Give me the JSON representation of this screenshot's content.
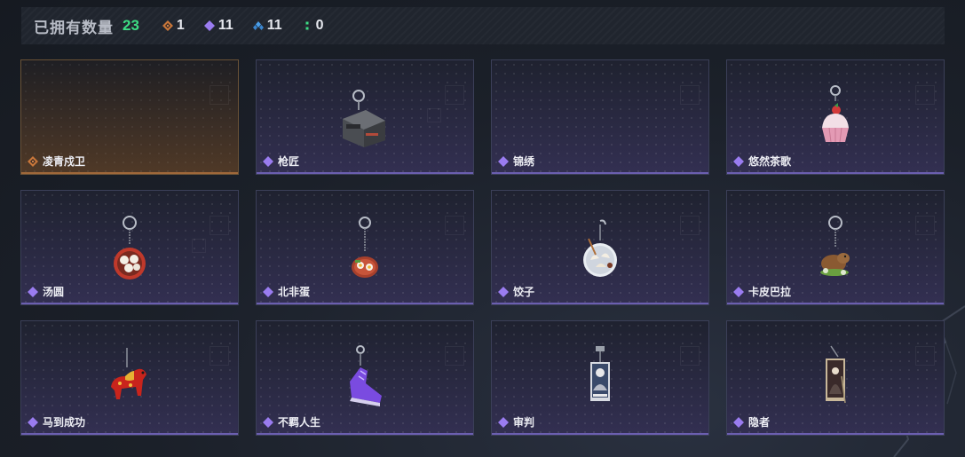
{
  "header": {
    "owned_label": "已拥有数量",
    "owned_count": "23",
    "rarity_counts": [
      {
        "icon": "gold-diamond-icon",
        "color": "#d0803c",
        "count": "1"
      },
      {
        "icon": "purple-diamond-icon",
        "color": "#9a7cf0",
        "count": "11"
      },
      {
        "icon": "blue-diamond-icon",
        "color": "#4a9ee8",
        "count": "11"
      },
      {
        "icon": "green-dots-icon",
        "color": "#3ddc84",
        "count": "0"
      }
    ]
  },
  "colors": {
    "accent_green": "#3ddc84",
    "purple_rarity": "#9a7cf0",
    "gold_rarity": "#d0803c"
  },
  "items": [
    {
      "name": "凌青戍卫",
      "rarity": "gold",
      "icon": "empty"
    },
    {
      "name": "枪匠",
      "rarity": "purple",
      "icon": "gun-case-charm-icon"
    },
    {
      "name": "锦绣",
      "rarity": "purple",
      "icon": "empty"
    },
    {
      "name": "悠然茶歌",
      "rarity": "purple",
      "icon": "cupcake-charm-icon"
    },
    {
      "name": "汤圆",
      "rarity": "purple",
      "icon": "tangyuan-bowl-charm-icon"
    },
    {
      "name": "北非蛋",
      "rarity": "purple",
      "icon": "shakshuka-charm-icon"
    },
    {
      "name": "饺子",
      "rarity": "purple",
      "icon": "dumplings-plate-charm-icon"
    },
    {
      "name": "卡皮巴拉",
      "rarity": "purple",
      "icon": "capybara-charm-icon"
    },
    {
      "name": "马到成功",
      "rarity": "purple",
      "icon": "red-horse-charm-icon"
    },
    {
      "name": "不羁人生",
      "rarity": "purple",
      "icon": "sneaker-charm-icon"
    },
    {
      "name": "审判",
      "rarity": "purple",
      "icon": "judgement-tarot-charm-icon"
    },
    {
      "name": "隐者",
      "rarity": "purple",
      "icon": "hermit-tarot-charm-icon"
    }
  ]
}
